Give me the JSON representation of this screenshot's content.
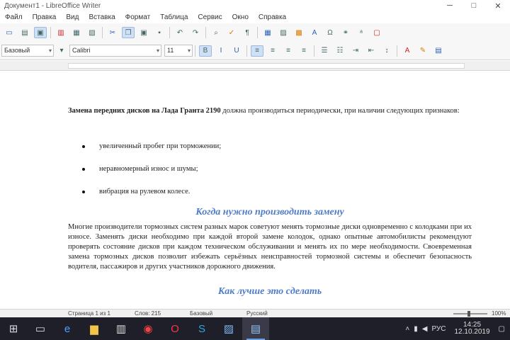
{
  "window": {
    "title": "Документ1 - LibreOffice Writer",
    "controls": {
      "minimize": "─",
      "maximize": "□",
      "close": "✕"
    }
  },
  "menu": [
    "Файл",
    "Правка",
    "Вид",
    "Вставка",
    "Формат",
    "Таблица",
    "Сервис",
    "Окно",
    "Справка"
  ],
  "toolbar2": {
    "style_value": "Базовый",
    "font_value": "Calibri",
    "size_value": "11"
  },
  "document": {
    "intro_bold": "Замена передних дисков на Лада Гранта 2190",
    "intro_rest": " должна производиться периодически, при наличии следующих признаков:",
    "bullets": [
      "увеличенный пробег при торможении;",
      "неравномерный износ и шумы;",
      "вибрация на рулевом колесе."
    ],
    "heading1": "Когда нужно производить замену",
    "body2": "Многие производители тормозных систем разных марок советуют менять тормозные диски одновременно с колодками при их износе. Заменять диски необходимо при каждой второй замене колодок, однако опытные автомобилисты рекомендуют проверять состояние дисков при каждом техническом обслуживании и менять их по мере необходимости. Своевременная замена тормозных дисков позволит избежать серьёзных неисправностей тормозной системы и обеспечит безопасность водителя, пассажиров и других участников дорожного движения.",
    "heading2": "Как лучше это сделать"
  },
  "status": {
    "page": "Страница 1 из 1",
    "words": "Слов: 215",
    "style": "Базовый",
    "lang": "Русский",
    "zoom": "100%"
  },
  "taskbar": {
    "tray_lang": "РУС",
    "time": "14:25",
    "date": "12.10.2019"
  }
}
